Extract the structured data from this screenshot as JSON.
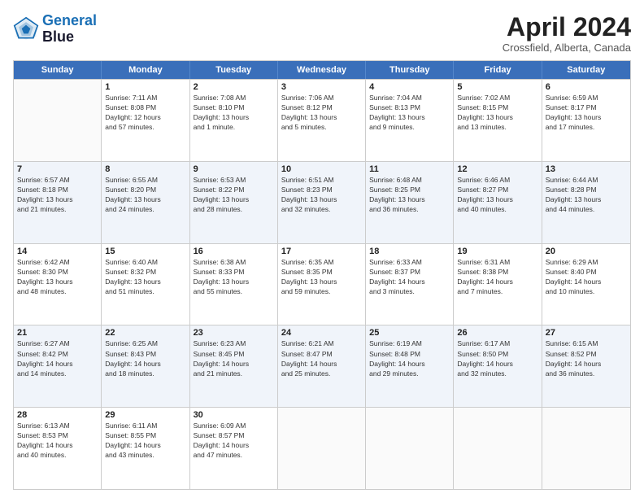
{
  "logo": {
    "line1": "General",
    "line2": "Blue"
  },
  "title": "April 2024",
  "location": "Crossfield, Alberta, Canada",
  "days_of_week": [
    "Sunday",
    "Monday",
    "Tuesday",
    "Wednesday",
    "Thursday",
    "Friday",
    "Saturday"
  ],
  "weeks": [
    [
      {
        "day": "",
        "lines": [],
        "empty": true
      },
      {
        "day": "1",
        "lines": [
          "Sunrise: 7:11 AM",
          "Sunset: 8:08 PM",
          "Daylight: 12 hours",
          "and 57 minutes."
        ],
        "empty": false
      },
      {
        "day": "2",
        "lines": [
          "Sunrise: 7:08 AM",
          "Sunset: 8:10 PM",
          "Daylight: 13 hours",
          "and 1 minute."
        ],
        "empty": false
      },
      {
        "day": "3",
        "lines": [
          "Sunrise: 7:06 AM",
          "Sunset: 8:12 PM",
          "Daylight: 13 hours",
          "and 5 minutes."
        ],
        "empty": false
      },
      {
        "day": "4",
        "lines": [
          "Sunrise: 7:04 AM",
          "Sunset: 8:13 PM",
          "Daylight: 13 hours",
          "and 9 minutes."
        ],
        "empty": false
      },
      {
        "day": "5",
        "lines": [
          "Sunrise: 7:02 AM",
          "Sunset: 8:15 PM",
          "Daylight: 13 hours",
          "and 13 minutes."
        ],
        "empty": false
      },
      {
        "day": "6",
        "lines": [
          "Sunrise: 6:59 AM",
          "Sunset: 8:17 PM",
          "Daylight: 13 hours",
          "and 17 minutes."
        ],
        "empty": false
      }
    ],
    [
      {
        "day": "7",
        "lines": [
          "Sunrise: 6:57 AM",
          "Sunset: 8:18 PM",
          "Daylight: 13 hours",
          "and 21 minutes."
        ],
        "empty": false
      },
      {
        "day": "8",
        "lines": [
          "Sunrise: 6:55 AM",
          "Sunset: 8:20 PM",
          "Daylight: 13 hours",
          "and 24 minutes."
        ],
        "empty": false
      },
      {
        "day": "9",
        "lines": [
          "Sunrise: 6:53 AM",
          "Sunset: 8:22 PM",
          "Daylight: 13 hours",
          "and 28 minutes."
        ],
        "empty": false
      },
      {
        "day": "10",
        "lines": [
          "Sunrise: 6:51 AM",
          "Sunset: 8:23 PM",
          "Daylight: 13 hours",
          "and 32 minutes."
        ],
        "empty": false
      },
      {
        "day": "11",
        "lines": [
          "Sunrise: 6:48 AM",
          "Sunset: 8:25 PM",
          "Daylight: 13 hours",
          "and 36 minutes."
        ],
        "empty": false
      },
      {
        "day": "12",
        "lines": [
          "Sunrise: 6:46 AM",
          "Sunset: 8:27 PM",
          "Daylight: 13 hours",
          "and 40 minutes."
        ],
        "empty": false
      },
      {
        "day": "13",
        "lines": [
          "Sunrise: 6:44 AM",
          "Sunset: 8:28 PM",
          "Daylight: 13 hours",
          "and 44 minutes."
        ],
        "empty": false
      }
    ],
    [
      {
        "day": "14",
        "lines": [
          "Sunrise: 6:42 AM",
          "Sunset: 8:30 PM",
          "Daylight: 13 hours",
          "and 48 minutes."
        ],
        "empty": false
      },
      {
        "day": "15",
        "lines": [
          "Sunrise: 6:40 AM",
          "Sunset: 8:32 PM",
          "Daylight: 13 hours",
          "and 51 minutes."
        ],
        "empty": false
      },
      {
        "day": "16",
        "lines": [
          "Sunrise: 6:38 AM",
          "Sunset: 8:33 PM",
          "Daylight: 13 hours",
          "and 55 minutes."
        ],
        "empty": false
      },
      {
        "day": "17",
        "lines": [
          "Sunrise: 6:35 AM",
          "Sunset: 8:35 PM",
          "Daylight: 13 hours",
          "and 59 minutes."
        ],
        "empty": false
      },
      {
        "day": "18",
        "lines": [
          "Sunrise: 6:33 AM",
          "Sunset: 8:37 PM",
          "Daylight: 14 hours",
          "and 3 minutes."
        ],
        "empty": false
      },
      {
        "day": "19",
        "lines": [
          "Sunrise: 6:31 AM",
          "Sunset: 8:38 PM",
          "Daylight: 14 hours",
          "and 7 minutes."
        ],
        "empty": false
      },
      {
        "day": "20",
        "lines": [
          "Sunrise: 6:29 AM",
          "Sunset: 8:40 PM",
          "Daylight: 14 hours",
          "and 10 minutes."
        ],
        "empty": false
      }
    ],
    [
      {
        "day": "21",
        "lines": [
          "Sunrise: 6:27 AM",
          "Sunset: 8:42 PM",
          "Daylight: 14 hours",
          "and 14 minutes."
        ],
        "empty": false
      },
      {
        "day": "22",
        "lines": [
          "Sunrise: 6:25 AM",
          "Sunset: 8:43 PM",
          "Daylight: 14 hours",
          "and 18 minutes."
        ],
        "empty": false
      },
      {
        "day": "23",
        "lines": [
          "Sunrise: 6:23 AM",
          "Sunset: 8:45 PM",
          "Daylight: 14 hours",
          "and 21 minutes."
        ],
        "empty": false
      },
      {
        "day": "24",
        "lines": [
          "Sunrise: 6:21 AM",
          "Sunset: 8:47 PM",
          "Daylight: 14 hours",
          "and 25 minutes."
        ],
        "empty": false
      },
      {
        "day": "25",
        "lines": [
          "Sunrise: 6:19 AM",
          "Sunset: 8:48 PM",
          "Daylight: 14 hours",
          "and 29 minutes."
        ],
        "empty": false
      },
      {
        "day": "26",
        "lines": [
          "Sunrise: 6:17 AM",
          "Sunset: 8:50 PM",
          "Daylight: 14 hours",
          "and 32 minutes."
        ],
        "empty": false
      },
      {
        "day": "27",
        "lines": [
          "Sunrise: 6:15 AM",
          "Sunset: 8:52 PM",
          "Daylight: 14 hours",
          "and 36 minutes."
        ],
        "empty": false
      }
    ],
    [
      {
        "day": "28",
        "lines": [
          "Sunrise: 6:13 AM",
          "Sunset: 8:53 PM",
          "Daylight: 14 hours",
          "and 40 minutes."
        ],
        "empty": false
      },
      {
        "day": "29",
        "lines": [
          "Sunrise: 6:11 AM",
          "Sunset: 8:55 PM",
          "Daylight: 14 hours",
          "and 43 minutes."
        ],
        "empty": false
      },
      {
        "day": "30",
        "lines": [
          "Sunrise: 6:09 AM",
          "Sunset: 8:57 PM",
          "Daylight: 14 hours",
          "and 47 minutes."
        ],
        "empty": false
      },
      {
        "day": "",
        "lines": [],
        "empty": true
      },
      {
        "day": "",
        "lines": [],
        "empty": true
      },
      {
        "day": "",
        "lines": [],
        "empty": true
      },
      {
        "day": "",
        "lines": [],
        "empty": true
      }
    ]
  ]
}
